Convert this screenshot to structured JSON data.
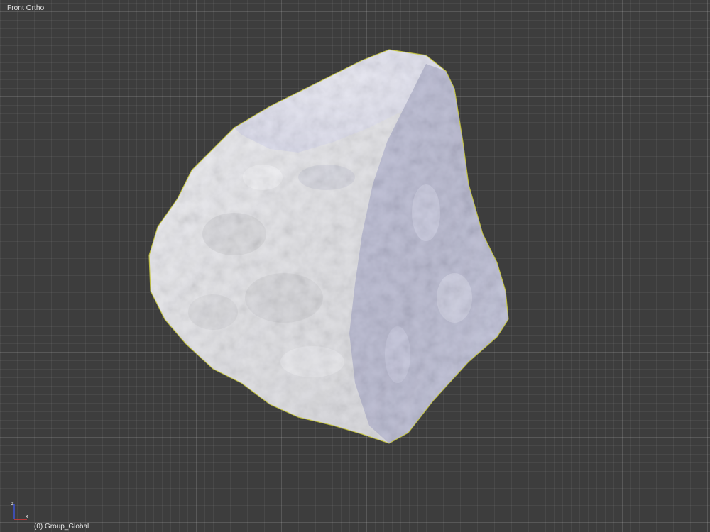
{
  "viewport": {
    "view_name": "Front Ortho",
    "object_info": "(0) Group_Global"
  },
  "gizmo": {
    "z_label": "z",
    "x_label": "x"
  },
  "colors": {
    "background": "#3d3d3d",
    "x_axis": "#8e2a2a",
    "z_axis": "#2a3ea6",
    "selection_outline": "#c8c83c",
    "rock_lit": "#c8c8d2",
    "rock_shadow": "#5c5f93"
  }
}
